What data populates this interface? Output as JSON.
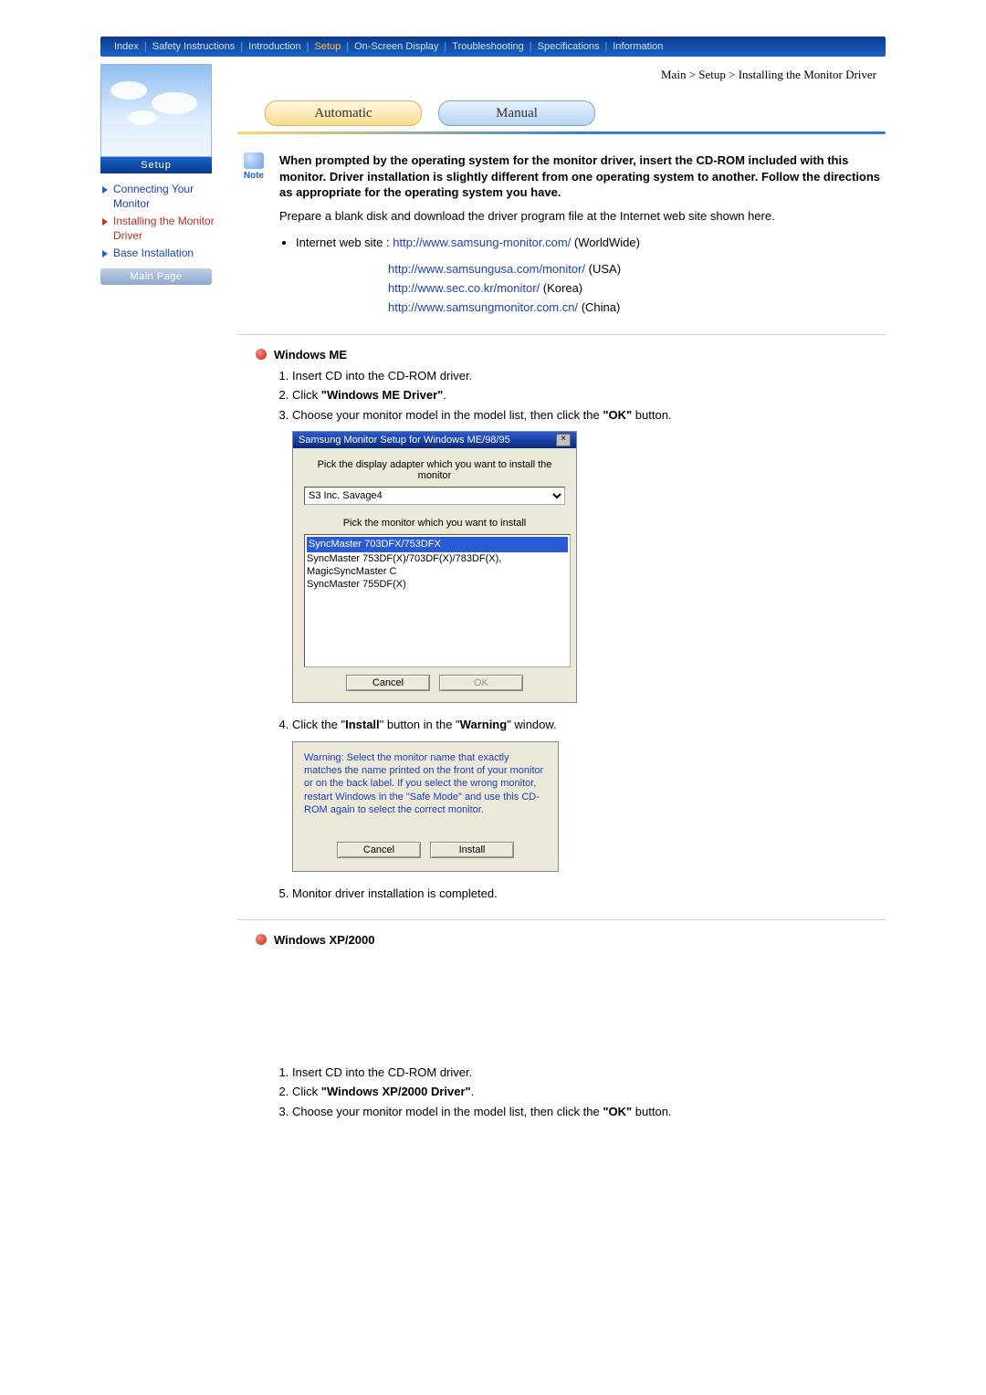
{
  "topnav": {
    "items": [
      "Index",
      "Safety Instructions",
      "Introduction",
      "Setup",
      "On-Screen Display",
      "Troubleshooting",
      "Specifications",
      "Information"
    ],
    "activeIndex": 3
  },
  "breadcrumb": "Main > Setup > Installing the Monitor Driver",
  "setup_label": "Setup",
  "sidebar": {
    "items": [
      {
        "label": "Connecting Your Monitor",
        "style": "blue"
      },
      {
        "label": "Installing the Monitor Driver",
        "style": "red"
      },
      {
        "label": "Base Installation",
        "style": "blue"
      }
    ],
    "main_page": "Main Page"
  },
  "tabs": {
    "auto": "Automatic",
    "manual": "Manual"
  },
  "note": {
    "badge": "Note",
    "text": "When prompted by the operating system for the monitor driver, insert the CD-ROM included with this monitor. Driver installation is slightly different from one operating system to another. Follow the directions as appropriate for the operating system you have."
  },
  "prepare_text": "Prepare a blank disk and download the driver program file at the Internet web site shown here.",
  "web_label": "Internet web site : ",
  "links": [
    {
      "url": "http://www.samsung-monitor.com/",
      "suffix": " (WorldWide)"
    },
    {
      "url": "http://www.samsungusa.com/monitor/",
      "suffix": " (USA)"
    },
    {
      "url": "http://www.sec.co.kr/monitor/",
      "suffix": " (Korea)"
    },
    {
      "url": "http://www.samsungmonitor.com.cn/",
      "suffix": " (China)"
    }
  ],
  "sections": {
    "me": {
      "title": "Windows ME",
      "steps": {
        "s1": "Insert CD into the CD-ROM driver.",
        "s2a": "Click ",
        "s2b": "\"Windows ME Driver\"",
        "s2c": ".",
        "s3a": "Choose your monitor model in the model list, then click the ",
        "s3b": "\"OK\"",
        "s3c": " button.",
        "s4a": "Click the \"",
        "s4b": "Install",
        "s4c": "\" button in the \"",
        "s4d": "Warning",
        "s4e": "\" window.",
        "s5": "Monitor driver installation is completed."
      },
      "dialog1": {
        "title": "Samsung Monitor Setup for Windows  ME/98/95",
        "adapter_label": "Pick the display adapter which you want to install the monitor",
        "adapter_value": "S3 Inc. Savage4",
        "monitor_label": "Pick the monitor which you want to install",
        "list": [
          "SyncMaster 703DFX/753DFX",
          "SyncMaster 753DF(X)/703DF(X)/783DF(X), MagicSyncMaster C",
          "SyncMaster 755DF(X)"
        ],
        "cancel": "Cancel",
        "ok": "OK"
      },
      "dialog2": {
        "msg": "Warning: Select the monitor name that exactly matches the name printed on the front of your monitor or on the back label. If you select the wrong monitor, restart Windows in the \"Safe Mode\" and use this CD-ROM again to select the correct monitor.",
        "cancel": "Cancel",
        "install": "Install"
      }
    },
    "xp": {
      "title": "Windows XP/2000",
      "steps": {
        "s1": "Insert CD into the CD-ROM driver.",
        "s2a": "Click ",
        "s2b": "\"Windows XP/2000 Driver\"",
        "s2c": ".",
        "s3a": "Choose your monitor model in the model list, then click the ",
        "s3b": "\"OK\"",
        "s3c": " button."
      }
    }
  }
}
